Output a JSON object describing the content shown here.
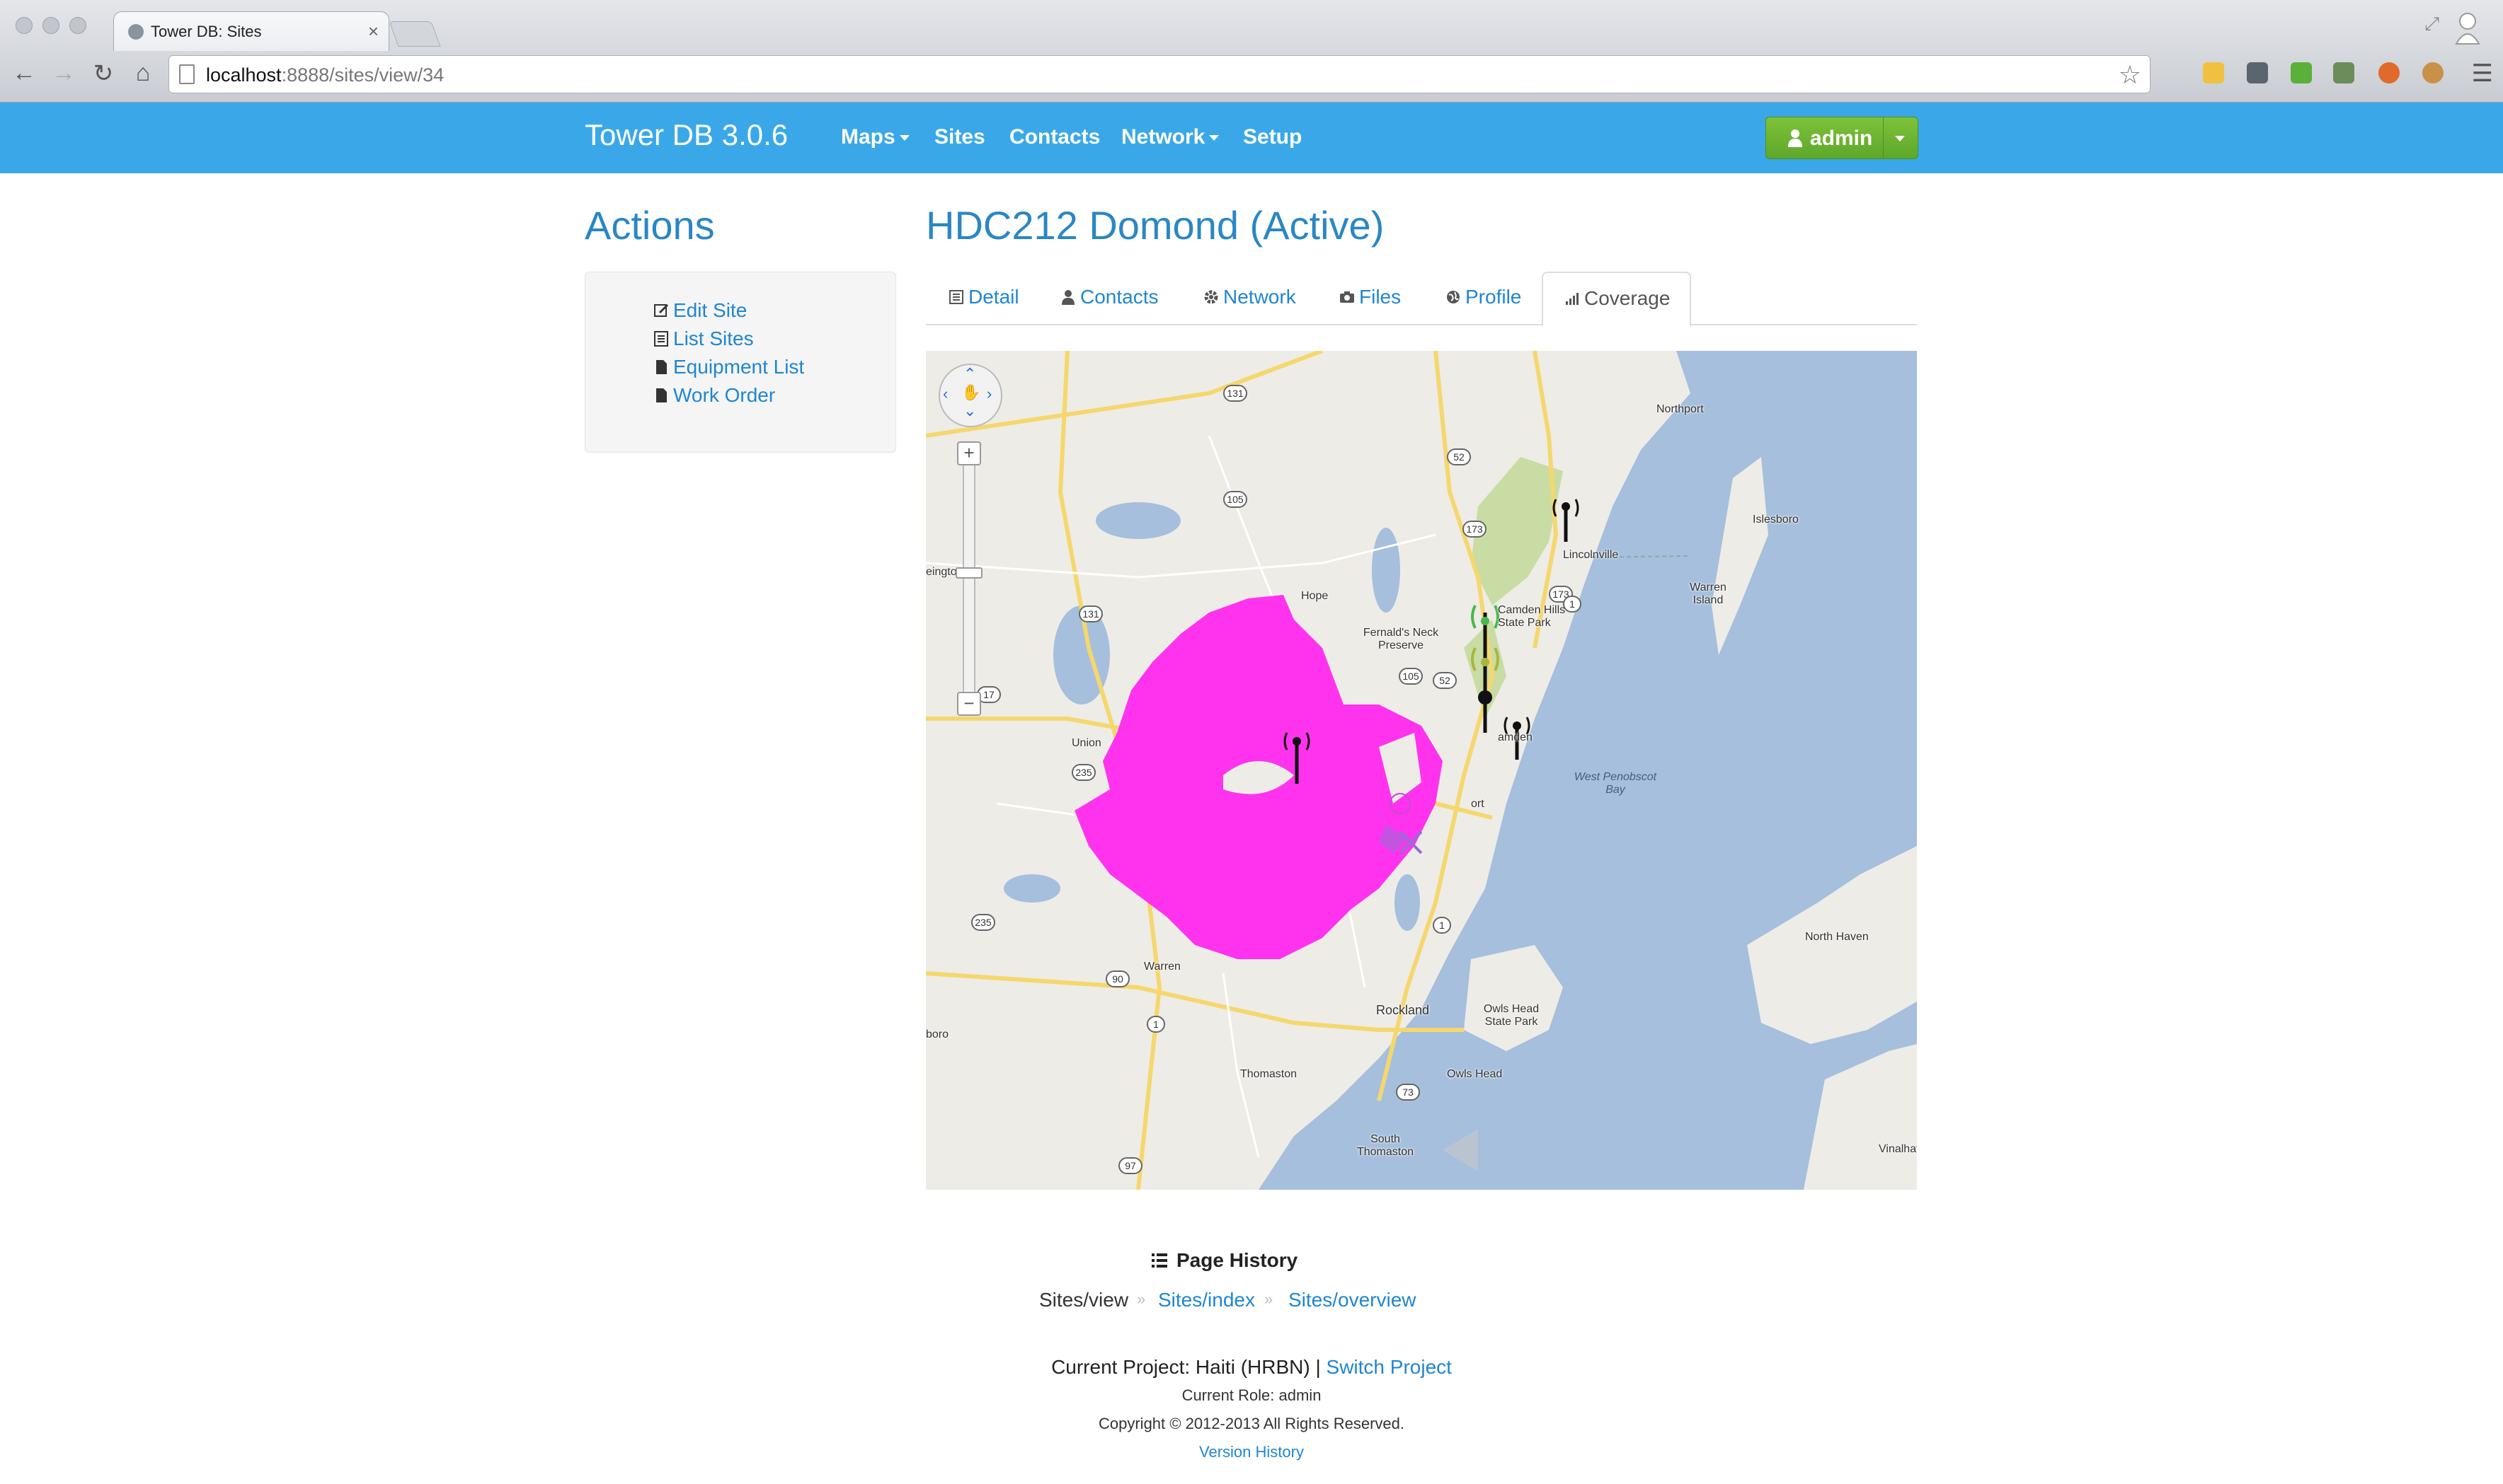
{
  "browser": {
    "tab_title": "Tower DB: Sites",
    "url_host": "localhost",
    "url_rest": ":8888/sites/view/34"
  },
  "app": {
    "brand": "Tower DB 3.0.6",
    "nav": [
      "Maps",
      "Sites",
      "Contacts",
      "Network",
      "Setup"
    ],
    "user": "admin"
  },
  "sidebar": {
    "title": "Actions",
    "actions": [
      "Edit Site",
      "List Sites",
      "Equipment List",
      "Work Order"
    ]
  },
  "main": {
    "title": "HDC212 Domond (Active)",
    "tabs": [
      "Detail",
      "Contacts",
      "Network",
      "Files",
      "Profile",
      "Coverage"
    ],
    "active_tab": "Coverage"
  },
  "map": {
    "coverage_color": "#ff33ee",
    "labels": [
      "Northport",
      "Islesboro",
      "Lincolnville",
      "Warren Island",
      "Hope",
      "Camden Hills State Park",
      "Fernald's Neck Preserve",
      "Union",
      "West Penobscot Bay",
      "North Haven",
      "Warren",
      "Rockland",
      "Owls Head State Park",
      "Owls Head",
      "Thomaston",
      "South Thomaston",
      "Vinalhaven",
      "amden",
      "ort",
      "eington",
      "boro"
    ],
    "road_shields": [
      "131",
      "173",
      "52",
      "105",
      "131",
      "173",
      "1",
      "105",
      "52",
      "17",
      "235",
      "235",
      "90",
      "1",
      "73",
      "97",
      "1"
    ]
  },
  "footer": {
    "history_title": "Page History",
    "breadcrumbs": [
      "Sites/view",
      "Sites/index",
      "Sites/overview"
    ],
    "project_prefix": "Current Project: Haiti (HRBN) |",
    "switch_project": "Switch Project",
    "role": "Current Role: admin",
    "copyright": "Copyright © 2012-2013 All Rights Reserved.",
    "version_history": "Version History"
  }
}
